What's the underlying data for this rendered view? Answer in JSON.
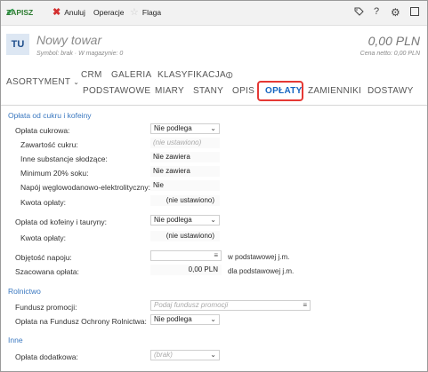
{
  "toolbar": {
    "save": "ZAPISZ",
    "cancel": "Anuluj",
    "operations": "Operacje",
    "flag": "Flaga"
  },
  "header": {
    "avatar": "TU",
    "title": "Nowy towar",
    "subtitle": "Symbol: brak  ·  W magazynie: 0",
    "price": "0,00 PLN",
    "price_net": "Cena netto: 0,00 PLN"
  },
  "tabs": {
    "asortyment": "ASORTYMENT",
    "top": [
      "CRM",
      "GALERIA",
      "KLASYFIKACJA"
    ],
    "bottom": [
      "PODSTAWOWE",
      "MIARY",
      "STANY",
      "OPIS",
      "OPŁATY",
      "ZAMIENNIKI",
      "DOSTAWY"
    ],
    "active": "OPŁATY"
  },
  "sugar": {
    "section": "Opłata od cukru i kofeiny",
    "fee_label": "Opłata cukrowa:",
    "fee_value": "Nie podlega",
    "sugar_content_label": "Zawartość cukru:",
    "sugar_content_value": "(nie ustawiono)",
    "other_sweet_label": "Inne substancje słodzące:",
    "other_sweet_value": "Nie zawiera",
    "juice_label": "Minimum 20% soku:",
    "juice_value": "Nie zawiera",
    "carb_label": "Napój węglowodanowo-elektrolityczny:",
    "carb_value": "Nie",
    "amount_label": "Kwota opłaty:",
    "amount_value": "(nie ustawiono)"
  },
  "caffeine": {
    "fee_label": "Opłata od kofeiny i tauryny:",
    "fee_value": "Nie podlega",
    "amount_label": "Kwota opłaty:",
    "amount_value": "(nie ustawiono)"
  },
  "volume": {
    "label": "Objętość napoju:",
    "unit": "w podstawowej j.m."
  },
  "estimated": {
    "label": "Szacowana opłata:",
    "value": "0,00 PLN",
    "unit": "dla podstawowej j.m."
  },
  "agri": {
    "section": "Rolnictwo",
    "fund_label": "Fundusz promocji:",
    "fund_placeholder": "Podaj fundusz promocji",
    "fund_fee_label": "Opłata na Fundusz Ochrony Rolnictwa:",
    "fund_fee_value": "Nie podlega"
  },
  "other": {
    "section": "Inne",
    "extra_label": "Opłata dodatkowa:",
    "extra_value": "(brak)"
  }
}
